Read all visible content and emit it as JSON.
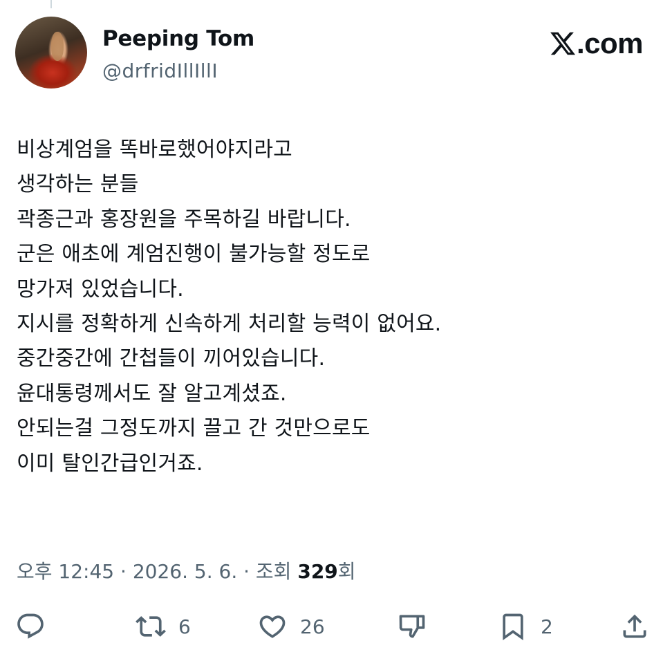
{
  "user": {
    "name": "Peeping Tom",
    "handle": "@drfridIllIllI"
  },
  "site": {
    "logo_text": ".com",
    "logo_icon": "x-logo-icon"
  },
  "tweet": {
    "lines": [
      "비상계엄을 똑바로했어야지라고",
      "생각하는 분들",
      "곽종근과 홍장원을 주목하길 바랍니다.",
      "군은 애초에 계엄진행이 불가능할 정도로",
      "망가져 있었습니다.",
      "지시를 정확하게 신속하게 처리할 능력이 없어요.",
      "중간중간에 간첩들이 끼어있습니다.",
      "윤대통령께서도 잘 알고계셨죠.",
      "안되는걸 그정도까지 끌고 간 것만으로도",
      "이미 탈인간급인거죠."
    ]
  },
  "meta": {
    "time": "오후 12:45",
    "separator": " · ",
    "date": "2026. 5. 6.",
    "views_label": "조회 ",
    "views_count": "329",
    "views_suffix": "회"
  },
  "actions": {
    "reply": {
      "icon": "reply-icon",
      "count": ""
    },
    "repost": {
      "icon": "repost-icon",
      "count": "6"
    },
    "like": {
      "icon": "heart-icon",
      "count": "26"
    },
    "dislike": {
      "icon": "thumbs-down-icon",
      "count": ""
    },
    "bookmark": {
      "icon": "bookmark-icon",
      "count": "2"
    },
    "share": {
      "icon": "share-icon",
      "count": ""
    }
  },
  "colors": {
    "text": "#0f1419",
    "secondary": "#536471",
    "background": "#ffffff"
  }
}
